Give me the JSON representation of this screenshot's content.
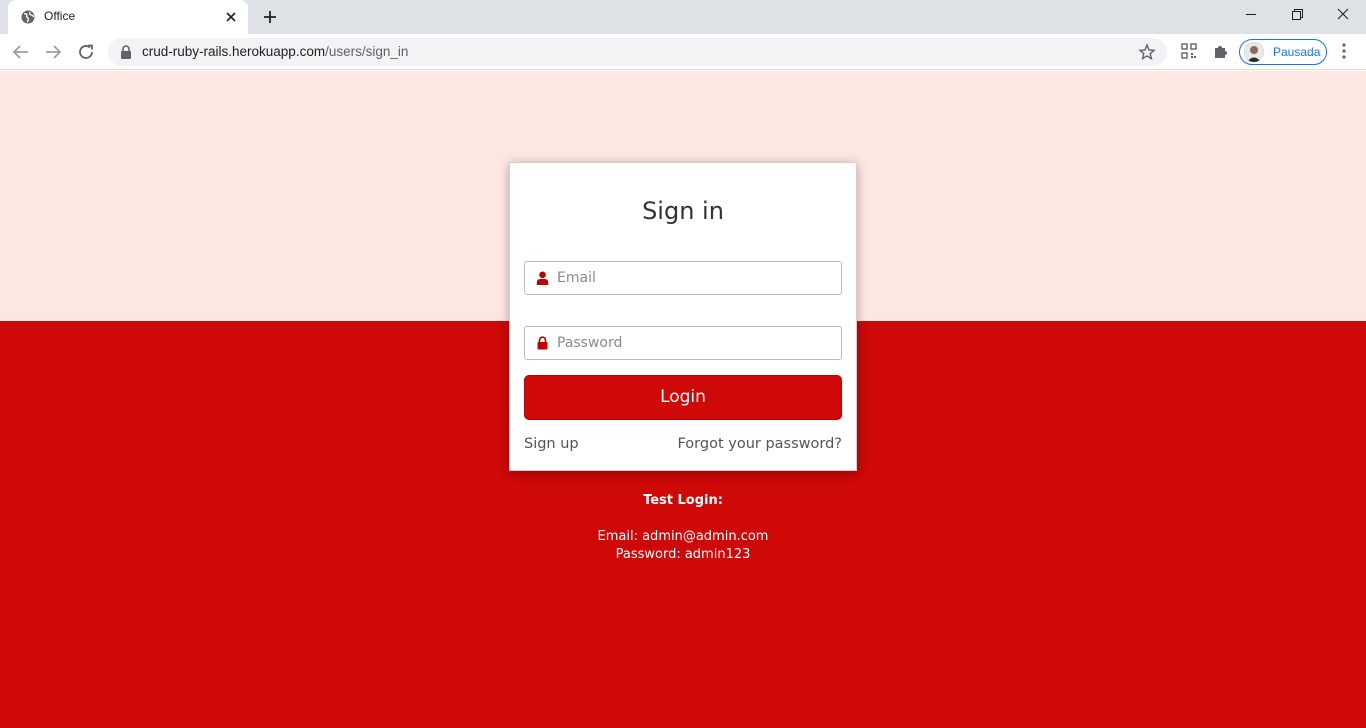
{
  "browser": {
    "tab_title": "Office",
    "url_host": "crud-ruby-rails.herokuapp.com",
    "url_path": "/users/sign_in",
    "profile_name": "Pausada"
  },
  "colors": {
    "brand_red": "#cf0808",
    "top_background": "#fde7e3",
    "icon_red": "#c00000"
  },
  "icons": {
    "email": "user-icon",
    "password": "lock-icon"
  },
  "signin": {
    "title": "Sign in",
    "email_placeholder": "Email",
    "password_placeholder": "Password",
    "login_label": "Login",
    "signup_label": "Sign up",
    "forgot_label": "Forgot your password?"
  },
  "test_login": {
    "heading": "Test Login:",
    "email_line": "Email: admin@admin.com",
    "password_line": "Password: admin123"
  }
}
